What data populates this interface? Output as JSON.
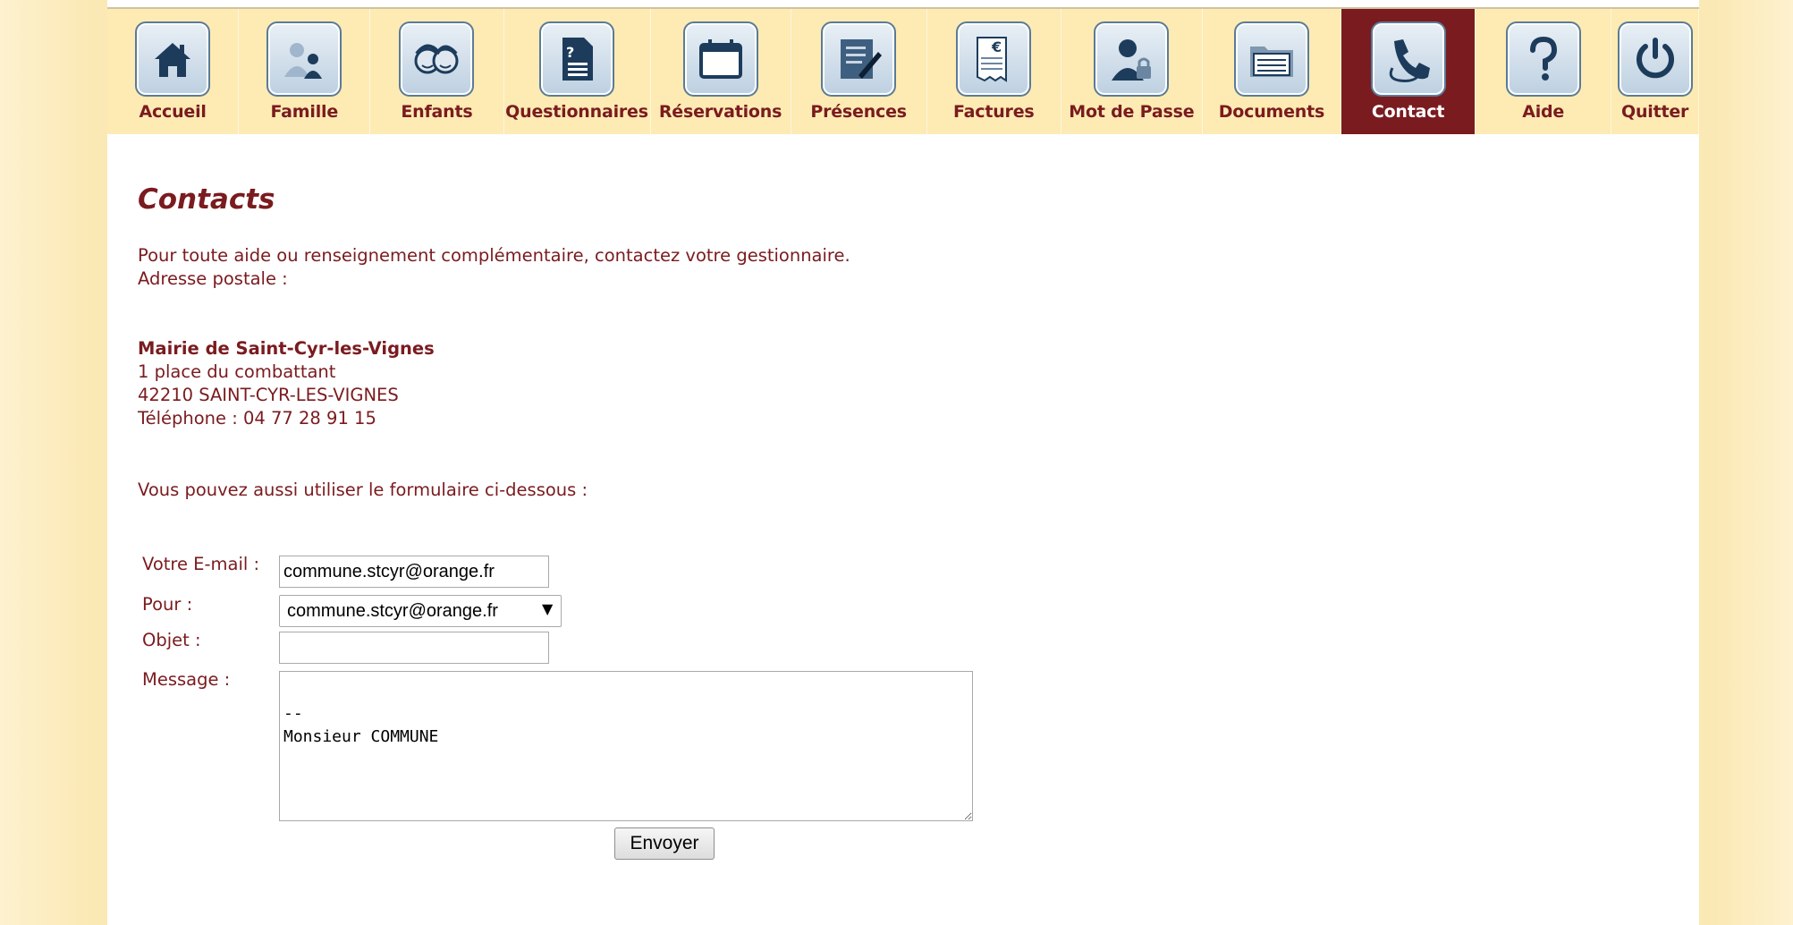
{
  "nav": {
    "items": [
      {
        "label": "Accueil",
        "icon": "home-icon",
        "active": false
      },
      {
        "label": "Famille",
        "icon": "family-icon",
        "active": false
      },
      {
        "label": "Enfants",
        "icon": "children-icon",
        "active": false
      },
      {
        "label": "Questionnaires",
        "icon": "questionnaire-icon",
        "active": false
      },
      {
        "label": "Réservations",
        "icon": "calendar-icon",
        "active": false
      },
      {
        "label": "Présences",
        "icon": "attendance-icon",
        "active": false
      },
      {
        "label": "Factures",
        "icon": "invoice-icon",
        "active": false
      },
      {
        "label": "Mot de Passe",
        "icon": "password-icon",
        "active": false
      },
      {
        "label": "Documents",
        "icon": "documents-icon",
        "active": false
      },
      {
        "label": "Contact",
        "icon": "phone-icon",
        "active": true
      },
      {
        "label": "Aide",
        "icon": "help-icon",
        "active": false
      },
      {
        "label": "Quitter",
        "icon": "power-icon",
        "active": false
      }
    ]
  },
  "page": {
    "title": "Contacts",
    "intro_line1": "Pour toute aide ou renseignement complémentaire, contactez votre gestionnaire.",
    "intro_line2": "Adresse postale :",
    "address": {
      "name": "Mairie de Saint-Cyr-les-Vignes",
      "street": "1 place du combattant",
      "city": "42210 SAINT-CYR-LES-VIGNES",
      "phone": "Téléphone : 04 77 28 91 15"
    },
    "form_intro": "Vous pouvez aussi utiliser le formulaire ci-dessous :"
  },
  "form": {
    "email_label": "Votre E-mail :",
    "email_value": "commune.stcyr@orange.fr",
    "to_label": "Pour :",
    "to_value": "commune.stcyr@orange.fr",
    "subject_label": "Objet :",
    "subject_value": "",
    "message_label": "Message :",
    "message_value": "\n--\nMonsieur COMMUNE",
    "send_label": "Envoyer"
  },
  "colors": {
    "accent": "#7a1b1f",
    "nav_background": "#fdebb3",
    "side_background": "#fbe9b5"
  }
}
